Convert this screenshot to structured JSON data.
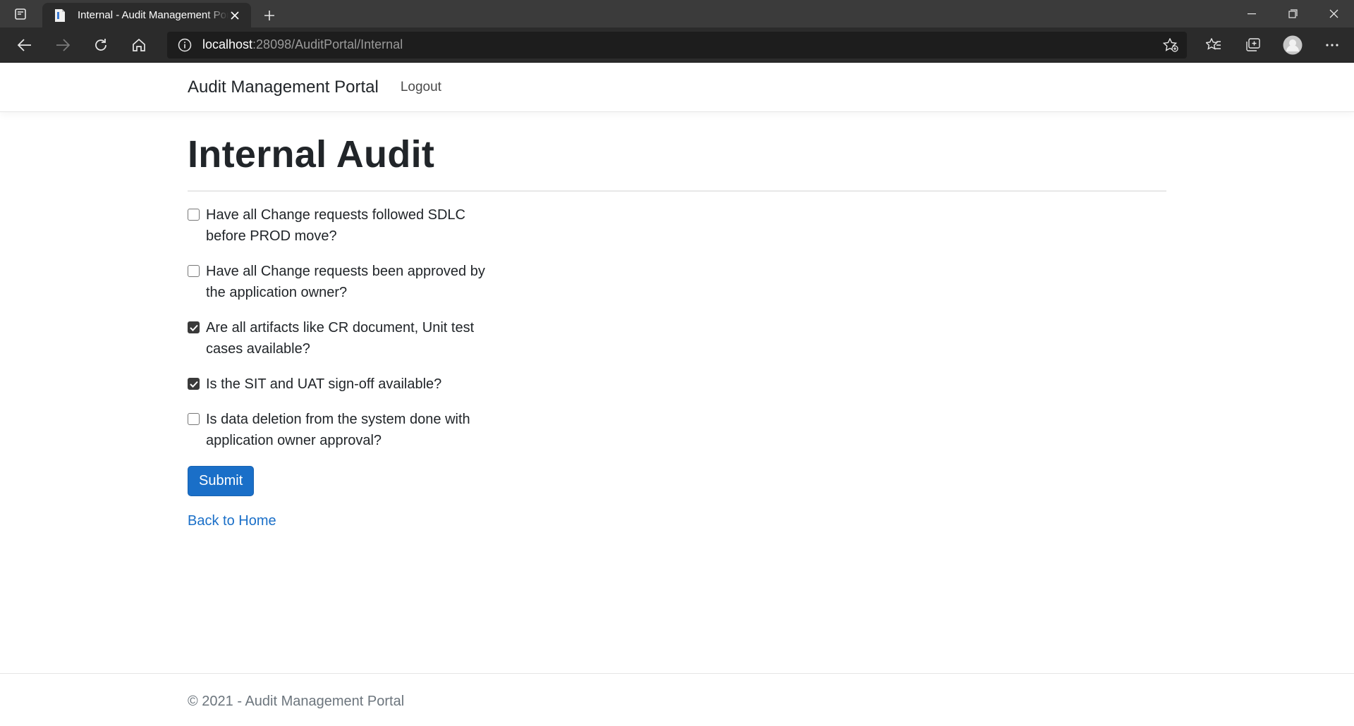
{
  "browser": {
    "tab_title": "Internal - Audit Management Portal",
    "url_host": "localhost",
    "url_rest": ":28098/AuditPortal/Internal",
    "icons": [
      "tab-actions-icon",
      "page-favicon-icon",
      "close-icon",
      "plus-icon",
      "minimize-icon",
      "restore-icon",
      "window-close-icon",
      "back-icon",
      "forward-icon",
      "refresh-icon",
      "home-icon",
      "info-icon",
      "add-favorite-icon",
      "favorites-icon",
      "collections-icon",
      "profile-icon",
      "more-icon"
    ]
  },
  "navbar": {
    "brand": "Audit Management Portal",
    "logout": "Logout"
  },
  "main": {
    "title": "Internal Audit",
    "questions": [
      {
        "label": "Have all Change requests followed SDLC before PROD move?",
        "checked": false
      },
      {
        "label": "Have all Change requests been approved by the application owner?",
        "checked": false
      },
      {
        "label": "Are all artifacts like CR document, Unit test cases available?",
        "checked": true
      },
      {
        "label": "Is the SIT and UAT sign-off available?",
        "checked": true
      },
      {
        "label": "Is data deletion from the system done with application owner approval?",
        "checked": false
      }
    ],
    "submit_label": "Submit",
    "back_link": "Back to Home"
  },
  "footer": {
    "text": "© 2021 - Audit Management Portal"
  },
  "colors": {
    "primary": "#1a6fc8",
    "chrome_dark": "#2b2b2b",
    "text": "#212529"
  }
}
